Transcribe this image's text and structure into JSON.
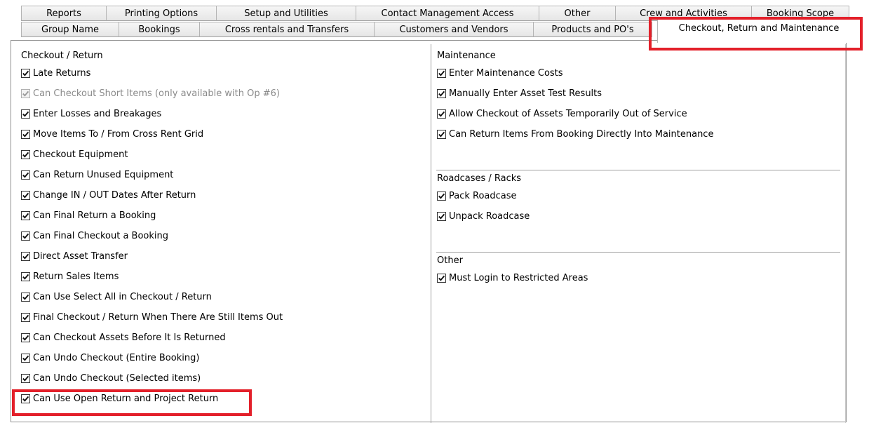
{
  "tabs_row1": [
    {
      "label": "Reports"
    },
    {
      "label": "Printing Options"
    },
    {
      "label": "Setup and Utilities"
    },
    {
      "label": "Contact Management Access"
    },
    {
      "label": "Other"
    },
    {
      "label": "Crew and Activities"
    },
    {
      "label": "Booking Scope"
    }
  ],
  "tabs_row2": [
    {
      "label": "Group Name"
    },
    {
      "label": "Bookings"
    },
    {
      "label": "Cross rentals and Transfers"
    },
    {
      "label": "Customers and Vendors"
    },
    {
      "label": "Products and PO's"
    },
    {
      "label": "Checkout, Return and Maintenance",
      "active": true
    }
  ],
  "left": {
    "title": "Checkout / Return",
    "items": [
      {
        "label": "Late Returns",
        "checked": true
      },
      {
        "label": "Can Checkout Short Items (only available with Op #6)",
        "checked": true,
        "disabled": true
      },
      {
        "label": "Enter Losses and Breakages",
        "checked": true
      },
      {
        "label": "Move Items To / From Cross Rent Grid",
        "checked": true
      },
      {
        "label": "Checkout Equipment",
        "checked": true
      },
      {
        "label": "Can Return Unused Equipment",
        "checked": true
      },
      {
        "label": "Change IN / OUT Dates After Return",
        "checked": true
      },
      {
        "label": "Can Final Return a Booking",
        "checked": true
      },
      {
        "label": "Can Final Checkout a Booking",
        "checked": true
      },
      {
        "label": "Direct Asset Transfer",
        "checked": true
      },
      {
        "label": "Return Sales Items",
        "checked": true
      },
      {
        "label": "Can Use Select All in Checkout / Return",
        "checked": true
      },
      {
        "label": "Final Checkout / Return When There Are Still Items Out",
        "checked": true
      },
      {
        "label": "Can Checkout Assets Before It Is Returned",
        "checked": true
      },
      {
        "label": "Can Undo Checkout (Entire Booking)",
        "checked": true
      },
      {
        "label": "Can Undo Checkout (Selected items)",
        "checked": true
      },
      {
        "label": "Can Use Open Return and Project Return",
        "checked": true
      }
    ]
  },
  "maintenance": {
    "title": "Maintenance",
    "items": [
      {
        "label": "Enter Maintenance Costs",
        "checked": true
      },
      {
        "label": "Manually Enter Asset Test Results",
        "checked": true
      },
      {
        "label": "Allow Checkout of Assets Temporarily Out of Service",
        "checked": true
      },
      {
        "label": "Can Return Items From Booking Directly Into Maintenance",
        "checked": true
      }
    ]
  },
  "roadcases": {
    "title": "Roadcases / Racks",
    "items": [
      {
        "label": "Pack Roadcase",
        "checked": true
      },
      {
        "label": "Unpack Roadcase",
        "checked": true
      }
    ]
  },
  "other": {
    "title": "Other",
    "items": [
      {
        "label": "Must Login to Restricted Areas",
        "checked": true
      }
    ]
  },
  "colors": {
    "highlight": "#e3202a"
  }
}
